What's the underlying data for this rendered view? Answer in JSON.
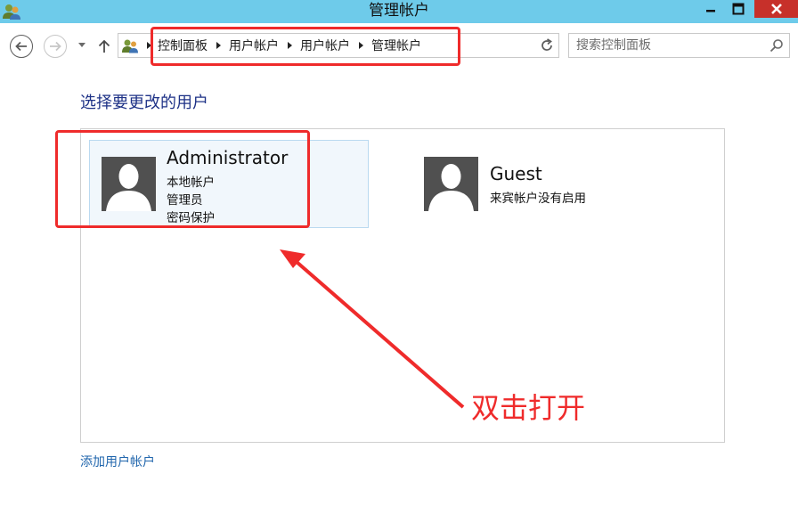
{
  "window": {
    "title": "管理帐户",
    "app_icon": "users-icon",
    "controls": [
      "minimize-icon",
      "maximize-icon",
      "close-icon"
    ]
  },
  "nav": {
    "back_icon": "back-arrow-icon",
    "forward_icon": "forward-arrow-icon",
    "recent_icon": "chevron-down-icon",
    "up_icon": "up-arrow-icon"
  },
  "address": {
    "breadcrumbs": [
      "控制面板",
      "用户帐户",
      "用户帐户",
      "管理帐户"
    ],
    "refresh_icon": "refresh-icon"
  },
  "search": {
    "placeholder": "搜索控制面板",
    "value": ""
  },
  "main": {
    "heading": "选择要更改的用户",
    "users": [
      {
        "name": "Administrator",
        "details": [
          "本地帐户",
          "管理员",
          "密码保护"
        ],
        "selected": true
      },
      {
        "name": "Guest",
        "details": [
          "来宾帐户没有启用"
        ],
        "selected": false
      }
    ],
    "add_account_link": "添加用户帐户"
  },
  "annotation": {
    "text": "双击打开",
    "color": "#ef2b2b"
  },
  "colors": {
    "titlebar": "#6ecbea",
    "close_button": "#c7302a",
    "heading": "#1e3287",
    "link": "#2166ad",
    "selected_tile": "#f1f7fc",
    "avatar": "#505050"
  }
}
